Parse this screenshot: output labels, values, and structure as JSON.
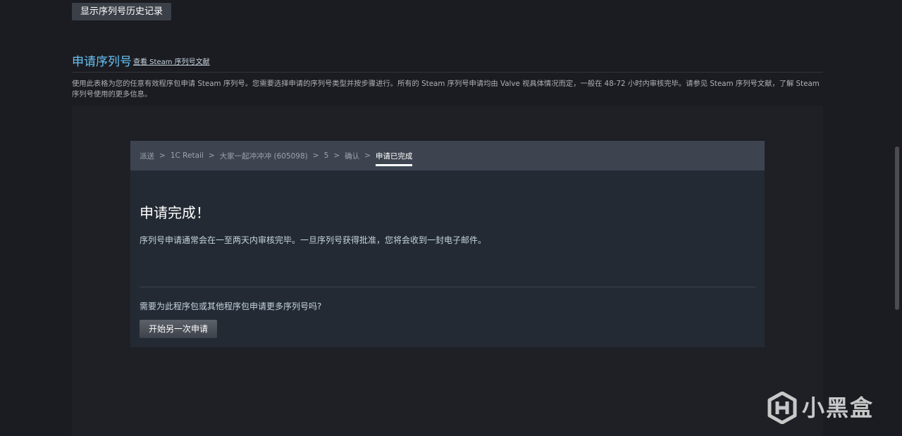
{
  "top_button": {
    "label": "显示序列号历史记录"
  },
  "section": {
    "title": "申请序列号",
    "link": "查看 Steam 序列号文献",
    "description": "使用此表格为您的任意有效程序包申请 Steam 序列号。您需要选择申请的序列号类型并按步骤进行。所有的 Steam 序列号申请均由 Valve 视具体情况而定，一般在 48-72 小时内审核完毕。请参见 Steam 序列号文献，了解 Steam 序列号使用的更多信息。"
  },
  "breadcrumbs": [
    "派送",
    "1C Retail",
    "大家一起冲冲冲 (605098)",
    "5",
    "确认",
    "申请已完成"
  ],
  "breadcrumb_separator": ">",
  "result": {
    "title": "申请完成！",
    "message": "序列号申请通常会在一至两天内审核完毕。一旦序列号获得批准，您将会收到一封电子邮件。",
    "more_question": "需要为此程序包或其他程序包申请更多序列号吗?",
    "restart_button": "开始另一次申请"
  },
  "watermark": {
    "text": "小黑盒",
    "icon": "heybox-logo-icon"
  },
  "colors": {
    "background": "#1b1c21",
    "accent_title": "#67c1f5",
    "breadcrumb_bar": "#3d4450",
    "card": "#232a33"
  }
}
